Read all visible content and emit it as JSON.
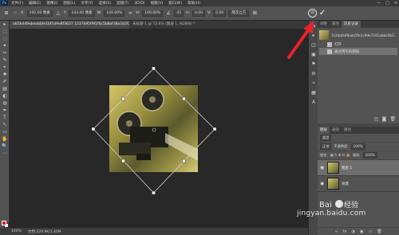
{
  "menubar": {
    "logo": "Ps",
    "items": [
      "文件(F)",
      "编辑(E)",
      "图像(I)",
      "图层(L)",
      "文字(Y)",
      "选择(S)",
      "滤镜(T)",
      "3D(D)",
      "视图(V)",
      "窗口(W)",
      "帮助(H)"
    ],
    "window_controls": [
      "—",
      "□",
      "✕"
    ]
  },
  "options": {
    "x_label": "X:",
    "x_value": "192.00 像素",
    "y_label": "Y:",
    "y_value": "143.00 像素",
    "w_label": "W:",
    "w_value": "100.00%",
    "h_label": "H:",
    "h_value": "100.00%",
    "angle_value": "45",
    "hskew_label": "H:",
    "hskew_value": "0.00",
    "vskew_label": "V:",
    "vskew_value": "0.00",
    "interp": "两次立方",
    "cancel_glyph": "⊘",
    "commit_glyph": "✓"
  },
  "tabs": [
    {
      "label": "ab5b4d9ebeabbfe1bf1d9e8f3637 1537b95f9f1f6c5b8af38a1b5f2f7fd72e1538.jpeg @ 100% (图层 1, RGB/8#) *",
      "active": true
    },
    {
      "label": "未标题-1 @ 72.6% (图层 1, RGB/8) *",
      "active": false
    }
  ],
  "toolbar": {
    "tools": [
      "▸",
      "⬚",
      "◌",
      "✦",
      "✂",
      "✎",
      "⌖",
      "✚",
      "✐",
      "▤",
      "◐",
      "◍",
      "✒",
      "T",
      "↖",
      "▭",
      "✋",
      "🔍",
      "⋯"
    ]
  },
  "status": {
    "zoom": "100%",
    "doc": "文档:229.9K/1.40M"
  },
  "rightstrip": {
    "icons": [
      "⇆",
      "▸",
      "◫",
      "▣",
      "⚑",
      "⚙",
      "✧",
      "▦",
      "A"
    ]
  },
  "history_panel": {
    "tabs": [
      "调整",
      "属性",
      "历史记录"
    ],
    "active_tab": "历史记录",
    "snapshot": "7c2dafe49ada5fe1c9de72d1abbe5b37...",
    "items": [
      {
        "label": "打开",
        "selected": false
      },
      {
        "label": "通过拷贝的图层",
        "selected": true
      }
    ],
    "footer_icons": [
      "◰",
      "◙",
      "🗑"
    ]
  },
  "layers_panel": {
    "tabs": [
      "图层",
      "通道",
      "路径"
    ],
    "kind": "类型",
    "blend": "正常",
    "opacity_label": "不透明度:",
    "opacity_value": "100%",
    "lock_label": "锁定:",
    "fill_label": "填充:",
    "fill_value": "100%",
    "layers": [
      {
        "name": "图层 1",
        "selected": true
      },
      {
        "name": "背景",
        "selected": false
      }
    ],
    "footer_icons": [
      "∞",
      "fx",
      "◑",
      "▣",
      "▭",
      "🗑"
    ]
  },
  "watermark": {
    "text": "jingyan.baidu.com",
    "logo_text": "Baidu 经验"
  },
  "colors": {
    "annotation_arrow": "#e8222b",
    "foreground": "#e02020",
    "background": "#ffffff"
  }
}
